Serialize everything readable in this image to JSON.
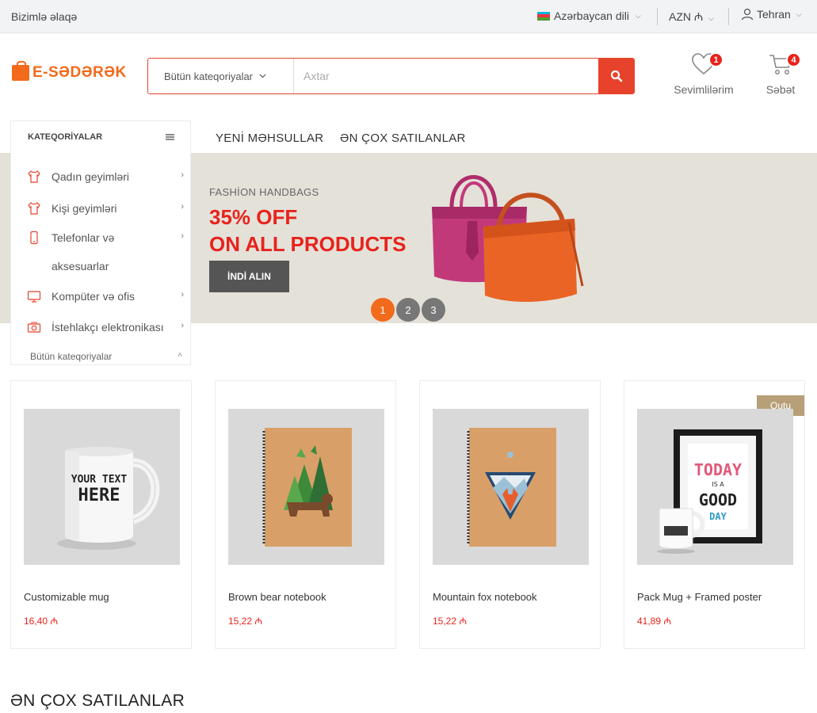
{
  "topbar": {
    "contact": "Bizimlə əlaqə",
    "language": "Azərbaycan dili",
    "currency": "AZN ₼",
    "user": "Tehran",
    "flag_colors": [
      "#00b5e2",
      "#ef3340",
      "#509e2f"
    ]
  },
  "header": {
    "logo_text": "E-SƏDƏRƏK",
    "search_category": "Bütün kateqoriyalar",
    "search_placeholder": "Axtar",
    "wishlist_label": "Sevimlilərim",
    "wishlist_count": "1",
    "cart_label": "Səbət",
    "cart_count": "4"
  },
  "categories": {
    "title": "KATEQORİYALAR",
    "items": [
      {
        "label": "Qadın geyimləri",
        "icon": "shirt-icon"
      },
      {
        "label": "Kişi geyimləri",
        "icon": "shirt-icon"
      },
      {
        "label": "Telefonlar və",
        "label2": "aksesuarlar",
        "icon": "phone-icon"
      },
      {
        "label": "Kompüter və ofis",
        "icon": "monitor-icon"
      },
      {
        "label": "İstehlakçı elektronikası",
        "icon": "camera-icon"
      }
    ],
    "all_label": "Bütün kateqoriyalar"
  },
  "nav": {
    "tab1": "YENİ MƏHSULLAR",
    "tab2": "ƏN ÇOX SATILANLAR"
  },
  "banner": {
    "subtitle": "FASHİON HANDBAGS",
    "title_line1": "35% OFF",
    "title_line2": "ON ALL PRODUCTS",
    "button": "İNDİ ALIN",
    "dots": [
      "1",
      "2",
      "3"
    ],
    "active_dot": 1
  },
  "products": [
    {
      "name": "Customizable mug",
      "price": "16,40 ₼",
      "tag": "",
      "mug_text_1": "YOUR TEXT",
      "mug_text_2": "HERE"
    },
    {
      "name": "Brown bear notebook",
      "price": "15,22 ₼",
      "tag": ""
    },
    {
      "name": "Mountain fox notebook",
      "price": "15,22 ₼",
      "tag": ""
    },
    {
      "name": "Pack Mug + Framed poster",
      "price": "41,89 ₼",
      "tag": "Qutu",
      "poster_1": "TODAY",
      "poster_2": "IS A",
      "poster_3": "GOOD",
      "poster_4": "DAY"
    }
  ],
  "section_title": "ƏN ÇOX SATILANLAR",
  "colors": {
    "accent": "#e7422b",
    "brand": "#f26a1b",
    "price": "#e7231b",
    "tag": "#b79f78"
  }
}
